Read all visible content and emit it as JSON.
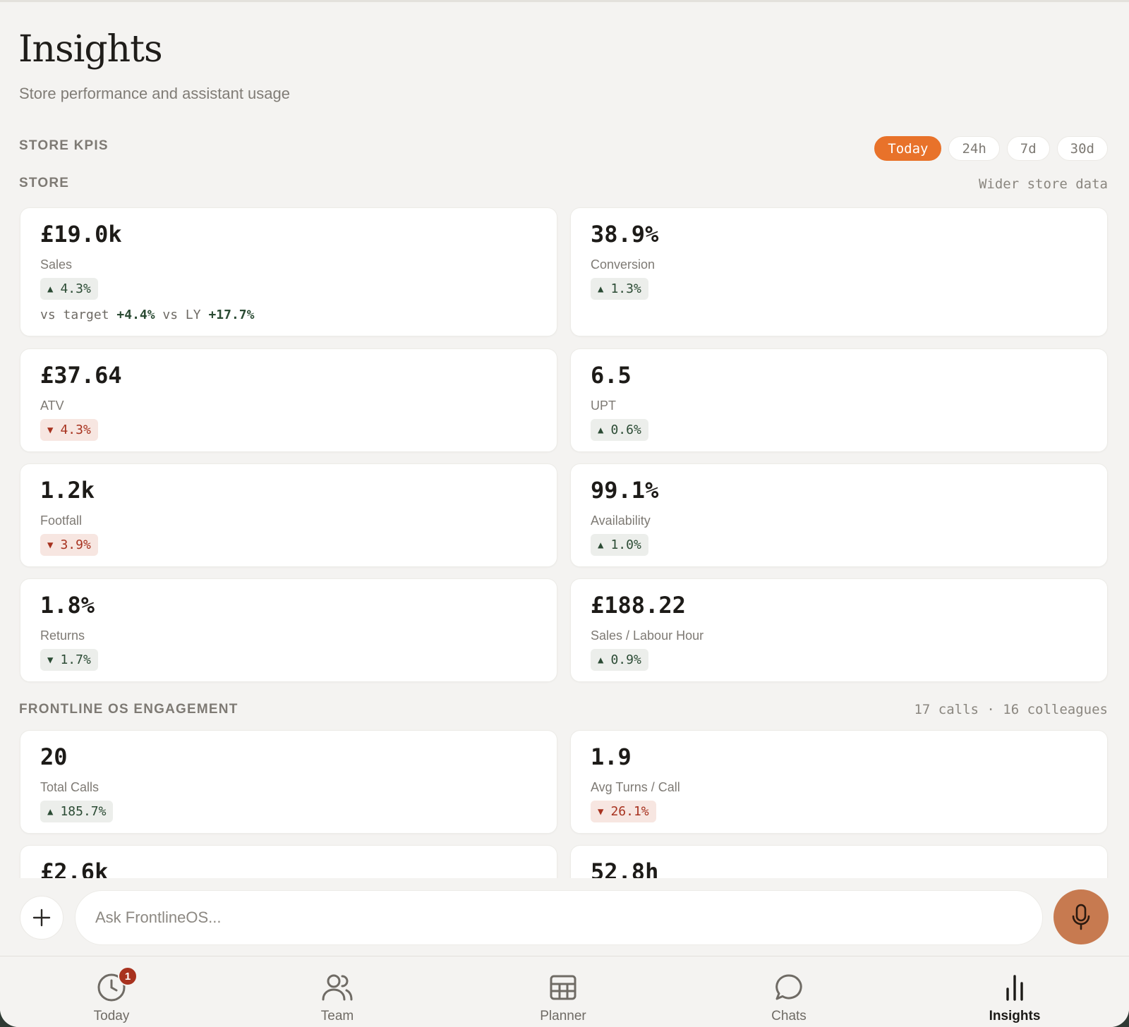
{
  "header": {
    "title": "Insights",
    "subtitle": "Store performance and assistant usage"
  },
  "kpis": {
    "section_label": "STORE KPIS",
    "ranges": [
      "Today",
      "24h",
      "7d",
      "30d"
    ],
    "active_range": "Today",
    "store_label": "STORE",
    "store_link": "Wider store data",
    "cards": [
      {
        "value": "£19.0k",
        "label": "Sales",
        "delta": "4.3%",
        "direction": "up",
        "arrow": "▲",
        "compare": {
          "target_label": "vs target",
          "target_value": "+4.4%",
          "ly_label": "vs LY",
          "ly_value": "+17.7%"
        }
      },
      {
        "value": "38.9%",
        "label": "Conversion",
        "delta": "1.3%",
        "direction": "up",
        "arrow": "▲"
      },
      {
        "value": "£37.64",
        "label": "ATV",
        "delta": "4.3%",
        "direction": "down-bad",
        "arrow": "▼"
      },
      {
        "value": "6.5",
        "label": "UPT",
        "delta": "0.6%",
        "direction": "up",
        "arrow": "▲"
      },
      {
        "value": "1.2k",
        "label": "Footfall",
        "delta": "3.9%",
        "direction": "down-bad",
        "arrow": "▼"
      },
      {
        "value": "99.1%",
        "label": "Availability",
        "delta": "1.0%",
        "direction": "up",
        "arrow": "▲"
      },
      {
        "value": "1.8%",
        "label": "Returns",
        "delta": "1.7%",
        "direction": "down-good",
        "arrow": "▼"
      },
      {
        "value": "£188.22",
        "label": "Sales / Labour Hour",
        "delta": "0.9%",
        "direction": "up",
        "arrow": "▲"
      }
    ]
  },
  "engagement": {
    "section_label": "FRONTLINE OS ENGAGEMENT",
    "summary": "17 calls · 16 colleagues",
    "cards": [
      {
        "value": "20",
        "label": "Total Calls",
        "delta": "185.7%",
        "direction": "up",
        "arrow": "▲"
      },
      {
        "value": "1.9",
        "label": "Avg Turns / Call",
        "delta": "26.1%",
        "direction": "down-bad",
        "arrow": "▼"
      },
      {
        "value": "£2.6k"
      },
      {
        "value": "52.8h"
      }
    ]
  },
  "composer": {
    "placeholder": "Ask FrontlineOS..."
  },
  "nav": {
    "items": [
      {
        "label": "Today",
        "icon": "clock-icon",
        "badge": "1"
      },
      {
        "label": "Team",
        "icon": "people-icon"
      },
      {
        "label": "Planner",
        "icon": "calendar-grid-icon"
      },
      {
        "label": "Chats",
        "icon": "chat-bubble-icon"
      },
      {
        "label": "Insights",
        "icon": "bar-chart-icon",
        "active": true
      }
    ]
  },
  "colors": {
    "accent": "#e8722a",
    "mic": "#c77a50",
    "positive": "#2b4b34",
    "negative": "#a7321f",
    "background": "#f4f3f1"
  }
}
